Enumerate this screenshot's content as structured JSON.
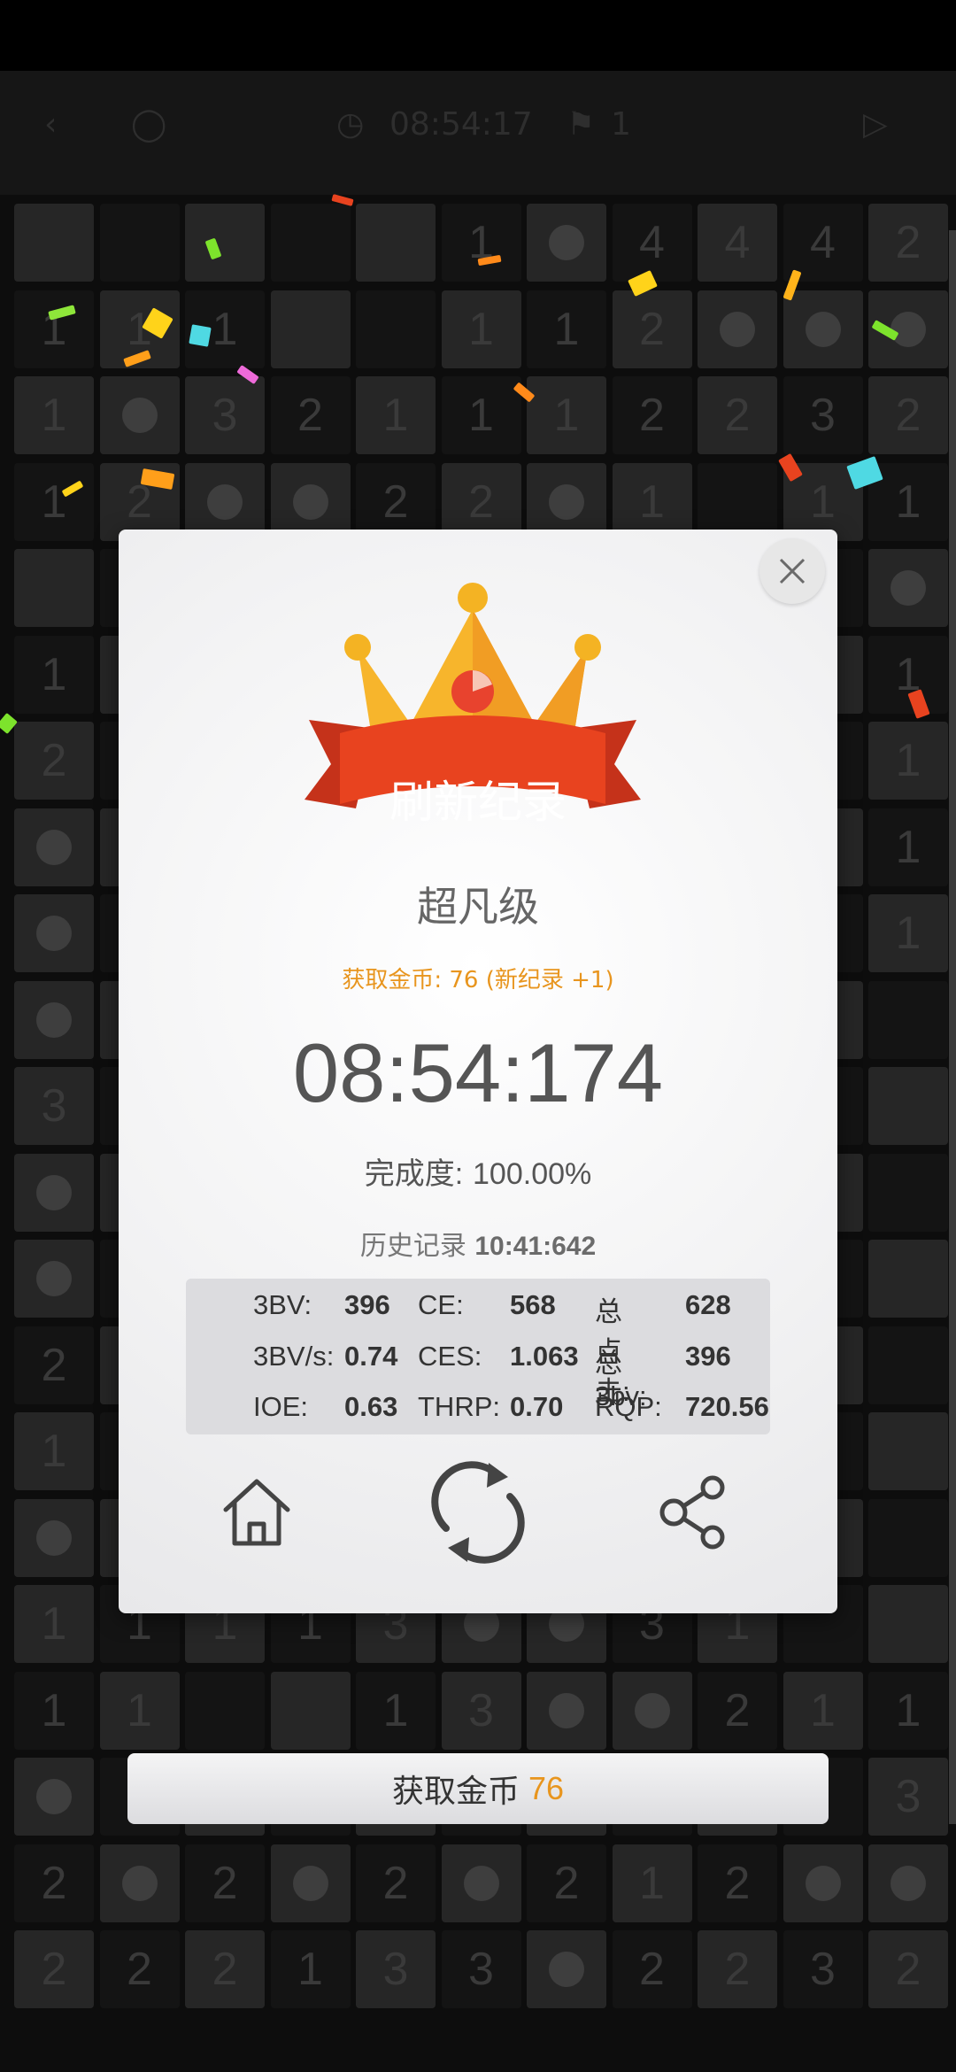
{
  "header": {
    "timer": "08:54:17",
    "flags": "1"
  },
  "board_rows": [
    [
      "",
      "",
      "",
      "",
      "",
      "1",
      "m",
      "4",
      "4",
      "4",
      "2"
    ],
    [
      "1",
      "1",
      "1",
      "",
      "",
      "1",
      "1",
      "2",
      "m",
      "m",
      "m"
    ],
    [
      "1",
      "m",
      "3",
      "2",
      "1",
      "1",
      "1",
      "2",
      "2",
      "3",
      "2"
    ],
    [
      "1",
      "2",
      "m",
      "m",
      "2",
      "2",
      "m",
      "1",
      "",
      "1",
      "1"
    ],
    [
      "",
      "",
      "",
      "",
      "",
      "",
      "",
      "",
      "",
      "",
      "m"
    ],
    [
      "1",
      "",
      "",
      "",
      "",
      "",
      "",
      "",
      "",
      "",
      "1"
    ],
    [
      "2",
      "",
      "",
      "",
      "",
      "",
      "",
      "",
      "",
      "",
      "1"
    ],
    [
      "m",
      "",
      "",
      "",
      "",
      "",
      "",
      "",
      "",
      "",
      "1"
    ],
    [
      "m",
      "",
      "",
      "",
      "",
      "",
      "",
      "",
      "",
      "",
      "1"
    ],
    [
      "m",
      "",
      "",
      "",
      "",
      "",
      "",
      "",
      "",
      "",
      ""
    ],
    [
      "3",
      "",
      "",
      "",
      "",
      "",
      "",
      "",
      "",
      "",
      ""
    ],
    [
      "m",
      "",
      "",
      "",
      "",
      "",
      "",
      "",
      "",
      "",
      ""
    ],
    [
      "m",
      "",
      "",
      "",
      "",
      "",
      "",
      "",
      "",
      "",
      ""
    ],
    [
      "2",
      "",
      "",
      "",
      "",
      "",
      "",
      "",
      "",
      "",
      ""
    ],
    [
      "1",
      "",
      "",
      "",
      "",
      "",
      "",
      "",
      "",
      "",
      ""
    ],
    [
      "m",
      "",
      "",
      "",
      "",
      "",
      "",
      "",
      "",
      "",
      ""
    ],
    [
      "1",
      "1",
      "1",
      "1",
      "3",
      "m",
      "m",
      "3",
      "1",
      "",
      ""
    ],
    [
      "1",
      "1",
      "",
      "",
      "1",
      "3",
      "m",
      "m",
      "2",
      "1",
      "1"
    ],
    [
      "m",
      "",
      "",
      "",
      "",
      "",
      "",
      "",
      "",
      "",
      "3"
    ],
    [
      "2",
      "m",
      "2",
      "m",
      "2",
      "m",
      "2",
      "1",
      "2",
      "m",
      "m"
    ],
    [
      "2",
      "2",
      "2",
      "1",
      "3",
      "3",
      "m",
      "2",
      "2",
      "3",
      "2"
    ]
  ],
  "dialog": {
    "record_label": "刷新纪录",
    "level_name": "超凡级",
    "coins_line": "获取金币: 76 (新纪录 +1)",
    "time": "08:54:174",
    "completion_label": "完成度:",
    "completion_value": "100.00%",
    "history_label": "历史记录",
    "history_value": "10:41:642",
    "stats": [
      {
        "label": "3BV:",
        "value": "396"
      },
      {
        "label": "CE:",
        "value": "568"
      },
      {
        "label": "总点击:",
        "value": "628"
      },
      {
        "label": "3BV/s:",
        "value": "0.74"
      },
      {
        "label": "CES:",
        "value": "1.063"
      },
      {
        "label": "总3bv:",
        "value": "396"
      },
      {
        "label": "IOE:",
        "value": "0.63"
      },
      {
        "label": "THRP:",
        "value": "0.70"
      },
      {
        "label": "RQP:",
        "value": "720.56"
      }
    ],
    "actions": [
      "home-icon",
      "restart-icon",
      "share-icon"
    ],
    "close_icon": "close-icon"
  },
  "coins_button": {
    "label": "获取金币",
    "value": "76"
  },
  "colors": {
    "accent": "#e8951e",
    "ribbon": "#e8431f",
    "crown": "#f7b52c"
  }
}
